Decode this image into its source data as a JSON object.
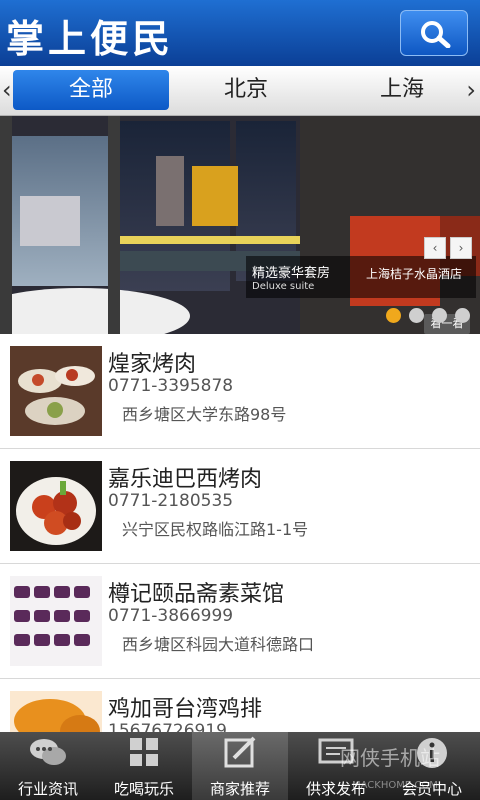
{
  "header": {
    "title": "掌上便民",
    "search_icon": "search-icon"
  },
  "city_tabs": {
    "items": [
      "全部",
      "北京",
      "上海"
    ],
    "active": 0
  },
  "banner": {
    "main_text": "精选豪华套房",
    "sub_text": "Deluxe suite",
    "hotel_text": "上海桔子水晶酒店",
    "look_button": "看一看",
    "prev": "‹",
    "next": "›",
    "dot_count": 4,
    "active_dot": 0
  },
  "merchants": [
    {
      "name": "煌家烤肉",
      "phone": "0771-3395878",
      "address": "西乡塘区大学东路98号"
    },
    {
      "name": "嘉乐迪巴西烤肉",
      "phone": "0771-2180535",
      "address": "兴宁区民权路临江路1-1号"
    },
    {
      "name": "樽记颐品斋素菜馆",
      "phone": "0771-3866999",
      "address": "西乡塘区科园大道科德路口"
    },
    {
      "name": "鸡加哥台湾鸡排",
      "phone": "15676726919",
      "address": ""
    }
  ],
  "tabbar": {
    "items": [
      {
        "label": "行业资讯",
        "icon": "chat-bubbles-icon"
      },
      {
        "label": "吃喝玩乐",
        "icon": "grid-icon"
      },
      {
        "label": "商家推荐",
        "icon": "edit-icon"
      },
      {
        "label": "供求发布",
        "icon": "publish-icon"
      },
      {
        "label": "会员中心",
        "icon": "info-icon"
      }
    ],
    "active": 2
  },
  "watermark": {
    "text": "网侠手机站",
    "sub": "MACKHOME.COM"
  },
  "colors": {
    "header_blue": "#0b3f96",
    "accent": "#2f86ea",
    "active_dot": "#f0a81c"
  }
}
